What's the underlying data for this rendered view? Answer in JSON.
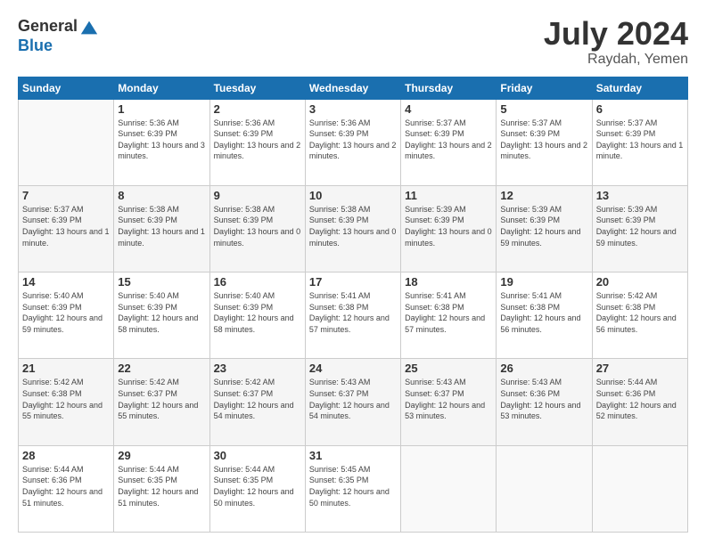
{
  "logo": {
    "general": "General",
    "blue": "Blue"
  },
  "title": {
    "month": "July 2024",
    "location": "Raydah, Yemen"
  },
  "headers": [
    "Sunday",
    "Monday",
    "Tuesday",
    "Wednesday",
    "Thursday",
    "Friday",
    "Saturday"
  ],
  "weeks": [
    [
      {
        "day": "",
        "sunrise": "",
        "sunset": "",
        "daylight": ""
      },
      {
        "day": "1",
        "sunrise": "Sunrise: 5:36 AM",
        "sunset": "Sunset: 6:39 PM",
        "daylight": "Daylight: 13 hours and 3 minutes."
      },
      {
        "day": "2",
        "sunrise": "Sunrise: 5:36 AM",
        "sunset": "Sunset: 6:39 PM",
        "daylight": "Daylight: 13 hours and 2 minutes."
      },
      {
        "day": "3",
        "sunrise": "Sunrise: 5:36 AM",
        "sunset": "Sunset: 6:39 PM",
        "daylight": "Daylight: 13 hours and 2 minutes."
      },
      {
        "day": "4",
        "sunrise": "Sunrise: 5:37 AM",
        "sunset": "Sunset: 6:39 PM",
        "daylight": "Daylight: 13 hours and 2 minutes."
      },
      {
        "day": "5",
        "sunrise": "Sunrise: 5:37 AM",
        "sunset": "Sunset: 6:39 PM",
        "daylight": "Daylight: 13 hours and 2 minutes."
      },
      {
        "day": "6",
        "sunrise": "Sunrise: 5:37 AM",
        "sunset": "Sunset: 6:39 PM",
        "daylight": "Daylight: 13 hours and 1 minute."
      }
    ],
    [
      {
        "day": "7",
        "sunrise": "Sunrise: 5:37 AM",
        "sunset": "Sunset: 6:39 PM",
        "daylight": "Daylight: 13 hours and 1 minute."
      },
      {
        "day": "8",
        "sunrise": "Sunrise: 5:38 AM",
        "sunset": "Sunset: 6:39 PM",
        "daylight": "Daylight: 13 hours and 1 minute."
      },
      {
        "day": "9",
        "sunrise": "Sunrise: 5:38 AM",
        "sunset": "Sunset: 6:39 PM",
        "daylight": "Daylight: 13 hours and 0 minutes."
      },
      {
        "day": "10",
        "sunrise": "Sunrise: 5:38 AM",
        "sunset": "Sunset: 6:39 PM",
        "daylight": "Daylight: 13 hours and 0 minutes."
      },
      {
        "day": "11",
        "sunrise": "Sunrise: 5:39 AM",
        "sunset": "Sunset: 6:39 PM",
        "daylight": "Daylight: 13 hours and 0 minutes."
      },
      {
        "day": "12",
        "sunrise": "Sunrise: 5:39 AM",
        "sunset": "Sunset: 6:39 PM",
        "daylight": "Daylight: 12 hours and 59 minutes."
      },
      {
        "day": "13",
        "sunrise": "Sunrise: 5:39 AM",
        "sunset": "Sunset: 6:39 PM",
        "daylight": "Daylight: 12 hours and 59 minutes."
      }
    ],
    [
      {
        "day": "14",
        "sunrise": "Sunrise: 5:40 AM",
        "sunset": "Sunset: 6:39 PM",
        "daylight": "Daylight: 12 hours and 59 minutes."
      },
      {
        "day": "15",
        "sunrise": "Sunrise: 5:40 AM",
        "sunset": "Sunset: 6:39 PM",
        "daylight": "Daylight: 12 hours and 58 minutes."
      },
      {
        "day": "16",
        "sunrise": "Sunrise: 5:40 AM",
        "sunset": "Sunset: 6:39 PM",
        "daylight": "Daylight: 12 hours and 58 minutes."
      },
      {
        "day": "17",
        "sunrise": "Sunrise: 5:41 AM",
        "sunset": "Sunset: 6:38 PM",
        "daylight": "Daylight: 12 hours and 57 minutes."
      },
      {
        "day": "18",
        "sunrise": "Sunrise: 5:41 AM",
        "sunset": "Sunset: 6:38 PM",
        "daylight": "Daylight: 12 hours and 57 minutes."
      },
      {
        "day": "19",
        "sunrise": "Sunrise: 5:41 AM",
        "sunset": "Sunset: 6:38 PM",
        "daylight": "Daylight: 12 hours and 56 minutes."
      },
      {
        "day": "20",
        "sunrise": "Sunrise: 5:42 AM",
        "sunset": "Sunset: 6:38 PM",
        "daylight": "Daylight: 12 hours and 56 minutes."
      }
    ],
    [
      {
        "day": "21",
        "sunrise": "Sunrise: 5:42 AM",
        "sunset": "Sunset: 6:38 PM",
        "daylight": "Daylight: 12 hours and 55 minutes."
      },
      {
        "day": "22",
        "sunrise": "Sunrise: 5:42 AM",
        "sunset": "Sunset: 6:37 PM",
        "daylight": "Daylight: 12 hours and 55 minutes."
      },
      {
        "day": "23",
        "sunrise": "Sunrise: 5:42 AM",
        "sunset": "Sunset: 6:37 PM",
        "daylight": "Daylight: 12 hours and 54 minutes."
      },
      {
        "day": "24",
        "sunrise": "Sunrise: 5:43 AM",
        "sunset": "Sunset: 6:37 PM",
        "daylight": "Daylight: 12 hours and 54 minutes."
      },
      {
        "day": "25",
        "sunrise": "Sunrise: 5:43 AM",
        "sunset": "Sunset: 6:37 PM",
        "daylight": "Daylight: 12 hours and 53 minutes."
      },
      {
        "day": "26",
        "sunrise": "Sunrise: 5:43 AM",
        "sunset": "Sunset: 6:36 PM",
        "daylight": "Daylight: 12 hours and 53 minutes."
      },
      {
        "day": "27",
        "sunrise": "Sunrise: 5:44 AM",
        "sunset": "Sunset: 6:36 PM",
        "daylight": "Daylight: 12 hours and 52 minutes."
      }
    ],
    [
      {
        "day": "28",
        "sunrise": "Sunrise: 5:44 AM",
        "sunset": "Sunset: 6:36 PM",
        "daylight": "Daylight: 12 hours and 51 minutes."
      },
      {
        "day": "29",
        "sunrise": "Sunrise: 5:44 AM",
        "sunset": "Sunset: 6:35 PM",
        "daylight": "Daylight: 12 hours and 51 minutes."
      },
      {
        "day": "30",
        "sunrise": "Sunrise: 5:44 AM",
        "sunset": "Sunset: 6:35 PM",
        "daylight": "Daylight: 12 hours and 50 minutes."
      },
      {
        "day": "31",
        "sunrise": "Sunrise: 5:45 AM",
        "sunset": "Sunset: 6:35 PM",
        "daylight": "Daylight: 12 hours and 50 minutes."
      },
      {
        "day": "",
        "sunrise": "",
        "sunset": "",
        "daylight": ""
      },
      {
        "day": "",
        "sunrise": "",
        "sunset": "",
        "daylight": ""
      },
      {
        "day": "",
        "sunrise": "",
        "sunset": "",
        "daylight": ""
      }
    ]
  ]
}
